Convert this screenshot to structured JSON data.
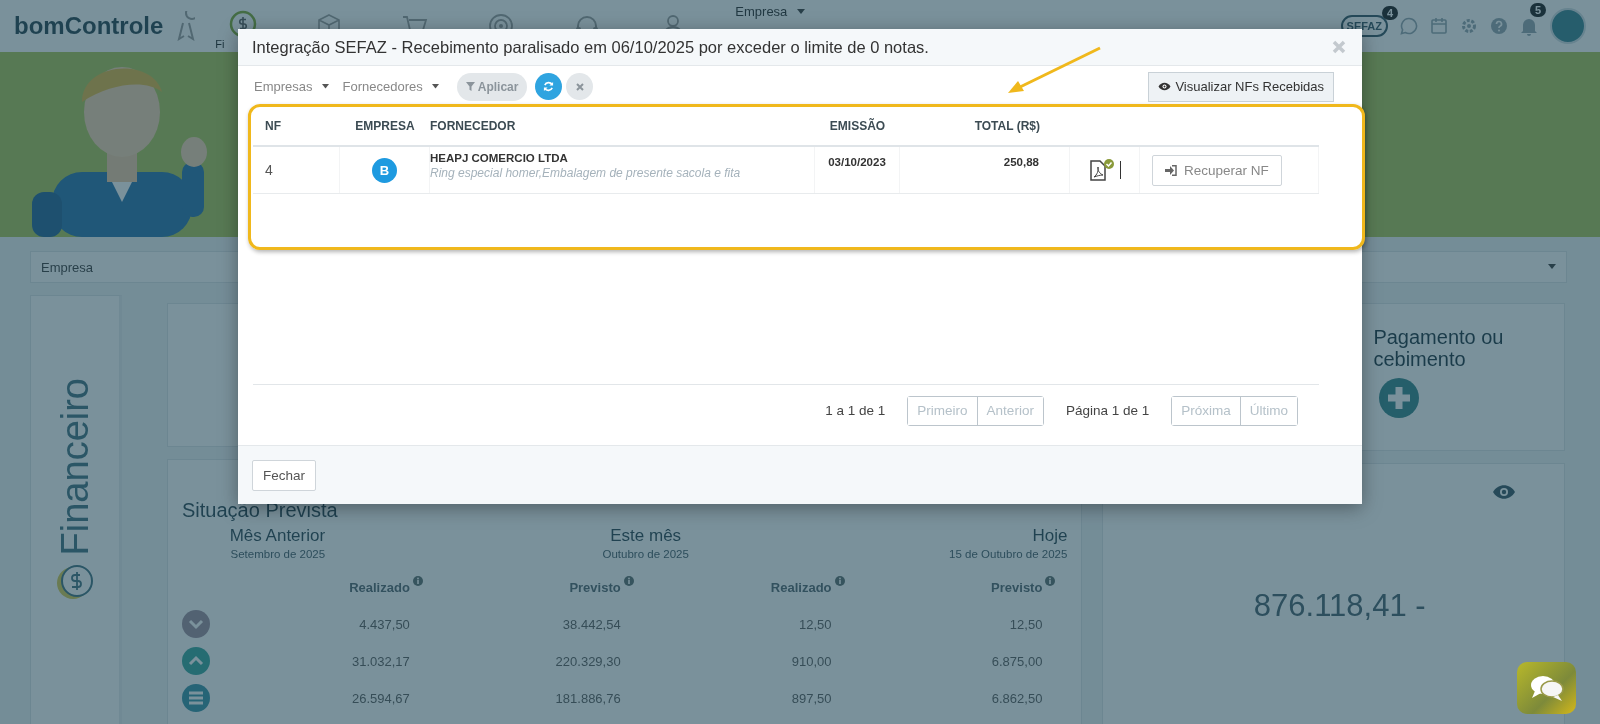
{
  "top_bar": {
    "logo": "bomControle",
    "nav_label": "Fi",
    "company_menu": "Empresa",
    "sefaz": "SEFAZ",
    "sefaz_count": "4",
    "notification_count": "5"
  },
  "company_select": {
    "placeholder": "Empresa"
  },
  "side_panel": {
    "title": "Financeiro"
  },
  "new_entry": {
    "title_lines": [
      "Pagamento ou",
      "cebimento"
    ]
  },
  "forecast": {
    "title": "Situação Prevista",
    "periods": [
      {
        "name": "Mês Anterior",
        "date": "Setembro de 2025"
      },
      {
        "name": "Este mês",
        "date": "Outubro de 2025"
      },
      {
        "name": "Hoje",
        "date": "15 de Outubro de 2025"
      }
    ],
    "columns": [
      "Realizado",
      "Previsto",
      "Realizado",
      "Previsto"
    ],
    "rows": [
      {
        "kind": "down",
        "values": [
          "4.437,50",
          "38.442,54",
          "12,50",
          "12,50"
        ]
      },
      {
        "kind": "up",
        "values": [
          "31.032,17",
          "220.329,30",
          "910,00",
          "6.875,00"
        ]
      },
      {
        "kind": "total",
        "values": [
          "26.594,67",
          "181.886,76",
          "897,50",
          "6.862,50"
        ]
      }
    ]
  },
  "balance": {
    "value": "876.118,41 -"
  },
  "modal": {
    "title": "Integração SEFAZ - Recebimento paralisado em 06/10/2025 por exceder o limite de 0 notas.",
    "filters": [
      {
        "label": "Empresas"
      },
      {
        "label": "Fornecedores"
      }
    ],
    "apply": "Aplicar",
    "view_button": "Visualizar NFs Recebidas",
    "columns": [
      "NF",
      "EMPRESA",
      "FORNECEDOR",
      "EMISSÃO",
      "TOTAL (R$)"
    ],
    "rows": [
      {
        "nf": "4",
        "company": "B",
        "supplier": "HEAPJ COMERCIO LTDA",
        "items": "Ring especial homer,Embalagem de presente sacola e fita",
        "date": "03/10/2023",
        "total": "250,88",
        "action": "Recuperar NF"
      }
    ],
    "range": "1 a 1 de 1",
    "page": "Página 1 de 1",
    "pager_left": [
      {
        "label": "Primeiro",
        "disabled": true
      },
      {
        "label": "Anterior",
        "disabled": true
      }
    ],
    "pager_right": [
      {
        "label": "Próxima",
        "disabled": true
      },
      {
        "label": "Último",
        "disabled": true
      }
    ],
    "close": "Fechar"
  }
}
